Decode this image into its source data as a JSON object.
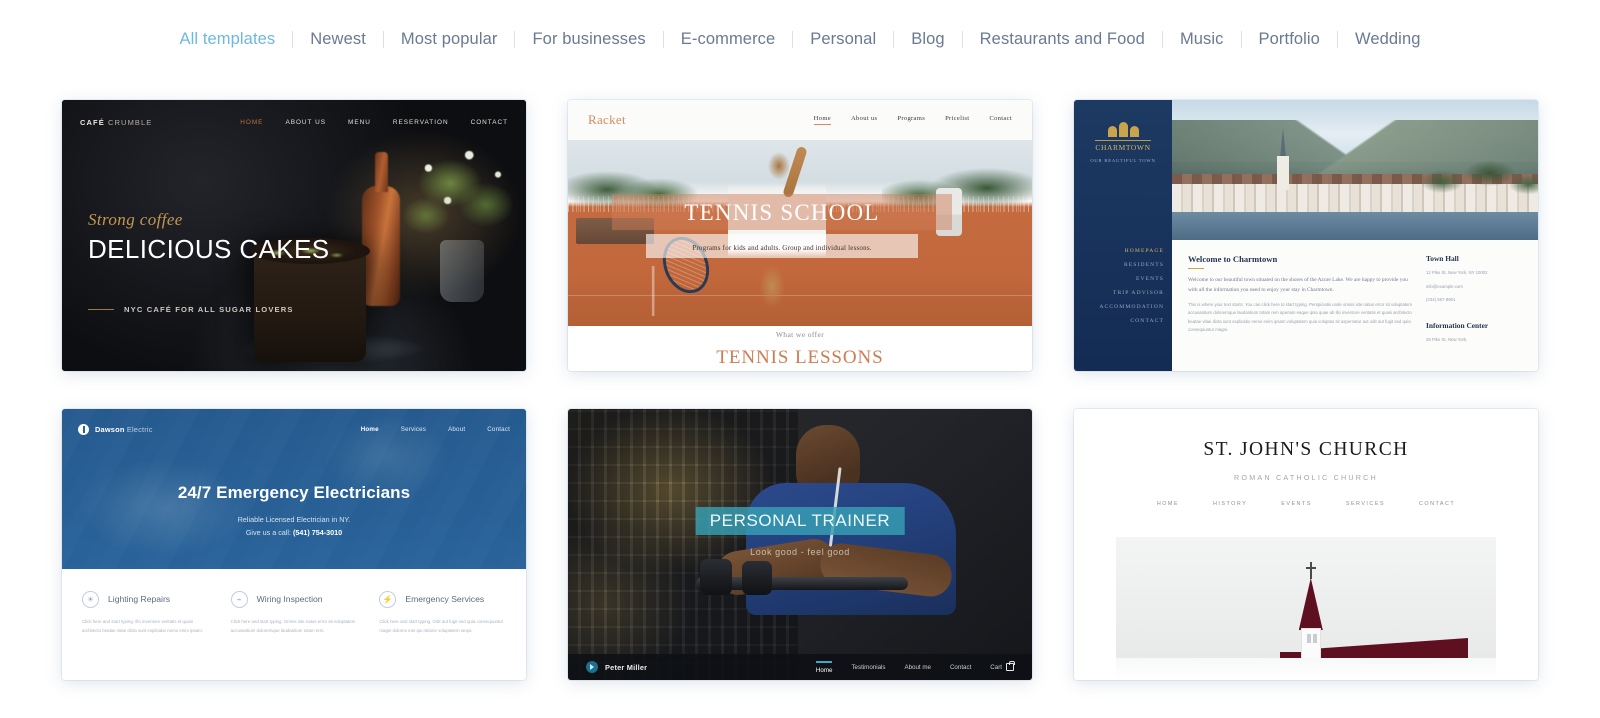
{
  "categories": [
    {
      "label": "All templates",
      "active": true
    },
    {
      "label": "Newest",
      "active": false
    },
    {
      "label": "Most popular",
      "active": false
    },
    {
      "label": "For businesses",
      "active": false
    },
    {
      "label": "E-commerce",
      "active": false
    },
    {
      "label": "Personal",
      "active": false
    },
    {
      "label": "Blog",
      "active": false
    },
    {
      "label": "Restaurants and Food",
      "active": false
    },
    {
      "label": "Music",
      "active": false
    },
    {
      "label": "Portfolio",
      "active": false
    },
    {
      "label": "Wedding",
      "active": false
    }
  ],
  "colors": {
    "active_tab": "#6cb9de",
    "tab": "#6a7a92",
    "page_bg": "#ffffff"
  },
  "templates": [
    {
      "id": "cafe-crumble",
      "logo": "CAFÉ",
      "logo_light": "CRUMBLE",
      "nav": [
        "HOME",
        "ABOUT US",
        "MENU",
        "RESERVATION",
        "CONTACT"
      ],
      "nav_active": "HOME",
      "eyebrow": "Strong coffee",
      "headline": "DELICIOUS CAKES",
      "tagline": "NYC CAFÉ FOR ALL SUGAR LOVERS"
    },
    {
      "id": "racket-tennis",
      "logo": "Racket",
      "nav": [
        "Home",
        "About us",
        "Programs",
        "Pricelist",
        "Contact"
      ],
      "nav_active": "Home",
      "headline": "TENNIS SCHOOL",
      "subtitle": "Programs for kids and adults. Group and individual lessons.",
      "section_eyebrow": "What we offer",
      "section_title": "TENNIS LESSONS"
    },
    {
      "id": "charmtown",
      "logo": "CHARMTOWN",
      "logo_slogan": "OUR BEAUTIFUL TOWN",
      "nav": [
        "HOMEPAGE",
        "RESIDENTS",
        "EVENTS",
        "TRIP ADVISOR",
        "ACCOMMODATION",
        "CONTACT"
      ],
      "nav_active": "HOMEPAGE",
      "heading": "Welcome to Charmtown",
      "lead": "Welcome to our beautiful town situated on the shores of the Azure Lake. We are happy to provide you with all the information you need to enjoy your stay in Charmtown.",
      "body": "This is where your text starts. You can click here to start typing. Perspiciatis unde omnis iste natus error sit voluptatem accusantium doloremque laudantium totam rem aperiam eaque ipsa quae ab illo inventore veritatis et quasi architecto beatae vitae dicta sunt explicabo nemo enim ipsam voluptatem quia voluptas sit aspernatur aut odit aut fugit sed quia consequuntur magni.",
      "sidebar": [
        {
          "title": "Town Hall",
          "lines": [
            "12 Pike St, New York, NY 10002",
            "info@example.com",
            "(234) 567-8901"
          ]
        },
        {
          "title": "Information Center",
          "lines": [
            "28 Pike St, New York,"
          ]
        }
      ]
    },
    {
      "id": "dawson-electric",
      "logo": "Dawson",
      "logo_light": "Electric",
      "nav": [
        "Home",
        "Services",
        "About",
        "Contact"
      ],
      "nav_active": "Home",
      "headline": "24/7 Emergency Electricians",
      "sub_line1": "Reliable Licensed Electrician in NY.",
      "sub_line2_prefix": "Give us a call: ",
      "phone": "(541) 754-3010",
      "services": [
        {
          "icon": "lightbulb-icon",
          "glyph": "☀",
          "title": "Lighting Repairs",
          "text": "Click here and start typing. Illo inventore veritatis et quasi architecto beatae vitae dicta sunt explicabo nemo enim ipsam."
        },
        {
          "icon": "wiring-icon",
          "glyph": "⌁",
          "title": "Wiring Inspection",
          "text": "Click here and start typing. Omnis iste natus error sit voluptatem accusantium doloremque laudantium totam rem."
        },
        {
          "icon": "emergency-icon",
          "glyph": "⚡",
          "title": "Emergency Services",
          "text": "Click here and start typing. Odit aut fugit sed quia consequuntur magni dolores eos qui ratione voluptatem sequi."
        }
      ]
    },
    {
      "id": "personal-trainer",
      "title": "PERSONAL TRAINER",
      "slogan": "Look good - feel good",
      "name": "Peter Miller",
      "nav": [
        "Home",
        "Testimonials",
        "About me",
        "Contact"
      ],
      "nav_active": "Home",
      "cart_label": "Cart",
      "accent": "#37a0b4"
    },
    {
      "id": "st-johns-church",
      "title": "ST. JOHN'S CHURCH",
      "subtitle": "ROMAN CATHOLIC CHURCH",
      "nav": [
        "HOME",
        "HISTORY",
        "EVENTS",
        "SERVICES",
        "CONTACT"
      ]
    }
  ]
}
